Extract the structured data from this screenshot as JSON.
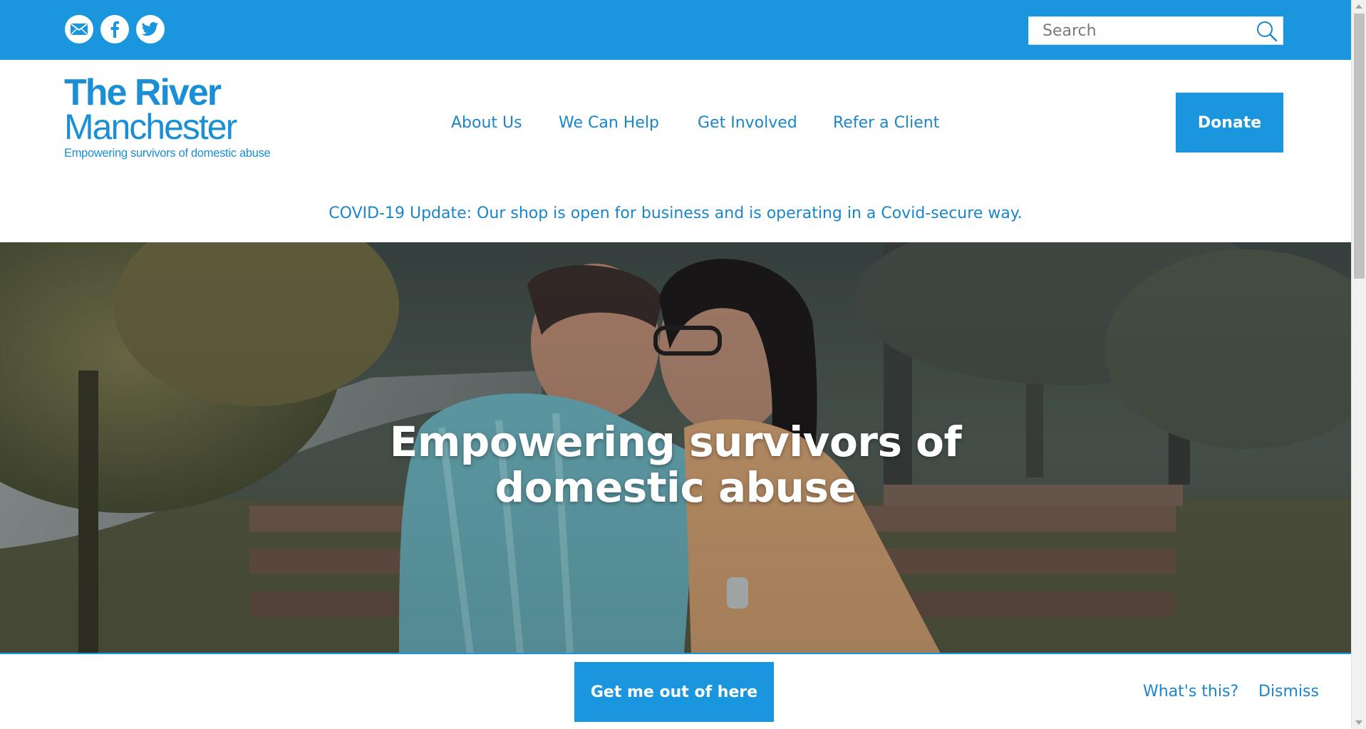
{
  "social": {
    "email_icon": "mail-icon",
    "facebook_icon": "facebook-icon",
    "twitter_icon": "twitter-icon"
  },
  "search": {
    "placeholder": "Search",
    "icon": "search-icon"
  },
  "logo": {
    "line1": "The River",
    "line2": "Manchester",
    "tagline": "Empowering survivors of domestic abuse"
  },
  "nav": {
    "items": [
      {
        "label": "About Us"
      },
      {
        "label": "We Can Help"
      },
      {
        "label": "Get Involved"
      },
      {
        "label": "Refer a Client"
      }
    ],
    "donate_label": "Donate"
  },
  "notice": "COVID-19 Update: Our shop is open for business and is operating in a Covid-secure way.",
  "hero": {
    "title_line1": "Empowering survivors of",
    "title_line2": "domestic abuse"
  },
  "quick_exit": {
    "button_label": "Get me out of here",
    "whats_this_label": "What's this?",
    "dismiss_label": "Dismiss"
  },
  "colors": {
    "brand_blue": "#1a96de",
    "link_blue": "#1a86c9",
    "white": "#ffffff"
  }
}
